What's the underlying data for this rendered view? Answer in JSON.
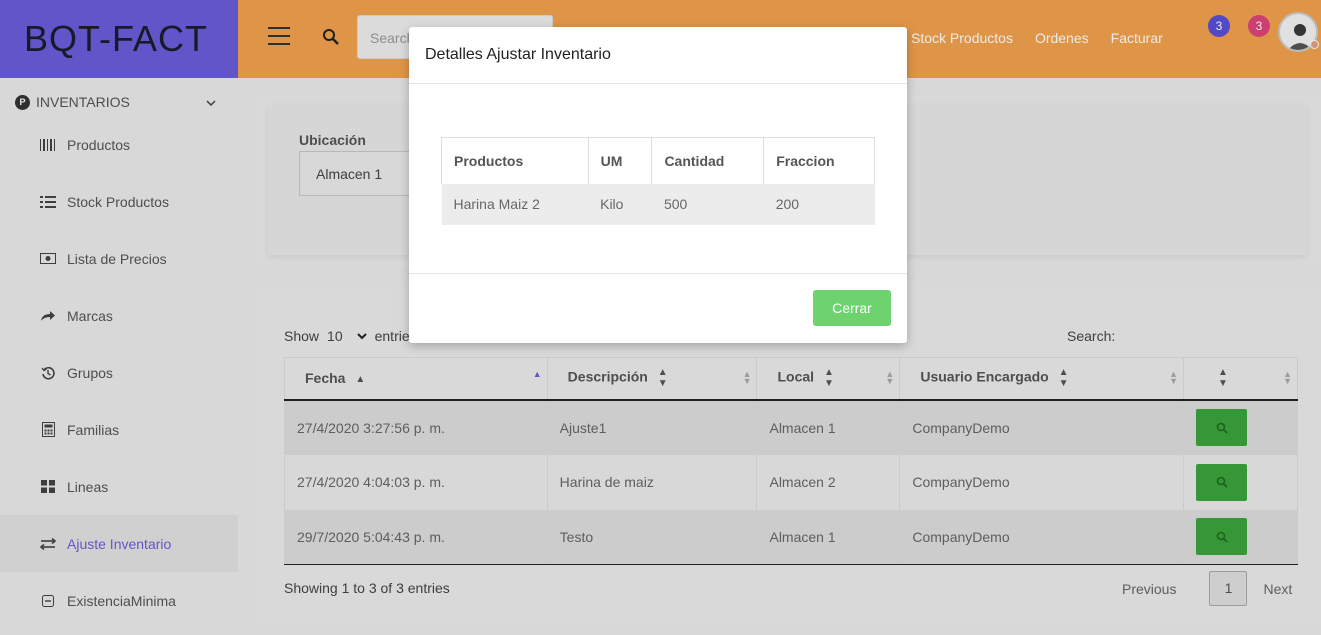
{
  "brand": "BQT-FACT",
  "topbar": {
    "search_placeholder": "Search",
    "links": [
      "Stock Productos",
      "Ordenes",
      "Facturar"
    ],
    "notifications": [
      {
        "count": "3",
        "color": "#5b4fd6"
      },
      {
        "count": "3",
        "color": "#e0457b"
      }
    ]
  },
  "sidebar": {
    "group": "INVENTARIOS",
    "items": [
      {
        "label": "Productos",
        "icon": "barcode-icon"
      },
      {
        "label": "Stock Productos",
        "icon": "list-icon"
      },
      {
        "label": "Lista de Precios",
        "icon": "money-icon"
      },
      {
        "label": "Marcas",
        "icon": "share-icon"
      },
      {
        "label": "Grupos",
        "icon": "history-icon"
      },
      {
        "label": "Familias",
        "icon": "calculator-icon"
      },
      {
        "label": "Lineas",
        "icon": "grid-icon"
      },
      {
        "label": "Ajuste Inventario",
        "icon": "exchange-icon",
        "active": true
      },
      {
        "label": "ExistenciaMinima",
        "icon": "minus-square-icon"
      }
    ]
  },
  "filter": {
    "label": "Ubicación",
    "selected": "Almacen 1"
  },
  "list": {
    "show_label": "Show",
    "entries_value": "10",
    "entries_label": "entries",
    "search_label": "Search:",
    "columns": [
      "Fecha",
      "Descripción",
      "Local",
      "Usuario Encargado",
      ""
    ],
    "rows": [
      {
        "fecha": "27/4/2020 3:27:56 p. m.",
        "descripcion": "Ajuste1",
        "local": "Almacen 1",
        "usuario": "CompanyDemo"
      },
      {
        "fecha": "27/4/2020 4:04:03 p. m.",
        "descripcion": "Harina de maiz",
        "local": "Almacen 2",
        "usuario": "CompanyDemo"
      },
      {
        "fecha": "29/7/2020 5:04:43 p. m.",
        "descripcion": "Testo",
        "local": "Almacen 1",
        "usuario": "CompanyDemo"
      }
    ],
    "showing": "Showing 1 to 3 of 3 entries",
    "previous": "Previous",
    "page": "1",
    "next": "Next"
  },
  "modal": {
    "title": "Detalles Ajustar Inventario",
    "columns": [
      "Productos",
      "UM",
      "Cantidad",
      "Fraccion"
    ],
    "rows": [
      {
        "producto": "Harina Maiz 2",
        "um": "Kilo",
        "cantidad": "500",
        "fraccion": "200"
      }
    ],
    "close_label": "Cerrar"
  }
}
